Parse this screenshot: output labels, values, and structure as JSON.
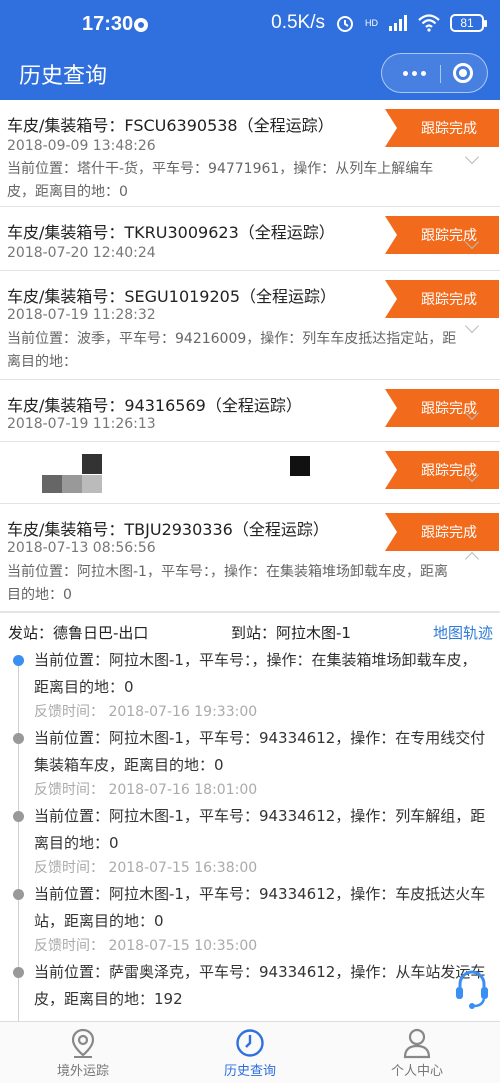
{
  "status_bar": {
    "time": "17:30",
    "net_speed": "0.5K/s",
    "battery": "81",
    "signal_label": "HD"
  },
  "header": {
    "title": "历史查询"
  },
  "records": [
    {
      "title": "车皮/集装箱号：FSCU6390538（全程运踪）",
      "date": "2018-09-09 13:48:26",
      "info": "当前位置：塔什干-货，平车号：94771961，操作：从列车上解编车皮，距离目的地：0",
      "button": "跟踪完成"
    },
    {
      "title": "车皮/集装箱号：TKRU3009623（全程运踪）",
      "date": "2018-07-20 12:40:24",
      "info": "",
      "button": "跟踪完成"
    },
    {
      "title": "车皮/集装箱号：SEGU1019205（全程运踪）",
      "date": "2018-07-19 11:28:32",
      "info": "当前位置：波季，平车号：94216009，操作：列车车皮抵达指定站，距离目的地：",
      "button": "跟踪完成"
    },
    {
      "title": "车皮/集装箱号：94316569（全程运踪）",
      "date": "2018-07-19 11:26:13",
      "info": "",
      "button": "跟踪完成"
    },
    {
      "title": "",
      "date": "",
      "info": "",
      "button": "跟踪完成"
    },
    {
      "title": "车皮/集装箱号：TBJU2930336（全程运踪）",
      "date": "2018-07-13 08:56:56",
      "info": "当前位置：阿拉木图-1，平车号：，操作：在集装箱堆场卸载车皮，距离目的地：0",
      "button": "跟踪完成"
    }
  ],
  "stations": {
    "from": "发站：德鲁日巴-出口",
    "to": "到站：阿拉木图-1",
    "map_link": "地图轨迹"
  },
  "timeline": [
    {
      "text": "当前位置：阿拉木图-1，平车号：，操作：在集装箱堆场卸载车皮，距离目的地：0",
      "feedback_time": "反馈时间：  2018-07-16 19:33:00"
    },
    {
      "text": "当前位置：阿拉木图-1，平车号：94334612，操作：在专用线交付集装箱车皮，距离目的地：0",
      "feedback_time": "反馈时间：  2018-07-16 18:01:00"
    },
    {
      "text": "当前位置：阿拉木图-1，平车号：94334612，操作：列车解组，距离目的地：0",
      "feedback_time": "反馈时间：  2018-07-15 16:38:00"
    },
    {
      "text": "当前位置：阿拉木图-1，平车号：94334612，操作：车皮抵达火车站，距离目的地：0",
      "feedback_time": "反馈时间：  2018-07-15 10:35:00"
    },
    {
      "text": "当前位置：萨雷奥泽克，平车号：94334612，操作：从车站发运车皮，距离目的地：192",
      "feedback_time": ""
    }
  ],
  "tabbar": {
    "items": [
      {
        "label": "境外运踪",
        "icon": "location-pin-icon",
        "active": false
      },
      {
        "label": "历史查询",
        "icon": "clock-icon",
        "active": true
      },
      {
        "label": "个人中心",
        "icon": "person-icon",
        "active": false
      }
    ]
  },
  "colors": {
    "primary": "#2f6fde",
    "track_button": "#f26a1b",
    "current_dot": "#3a8ff2",
    "map_link": "#2f7ad8"
  }
}
